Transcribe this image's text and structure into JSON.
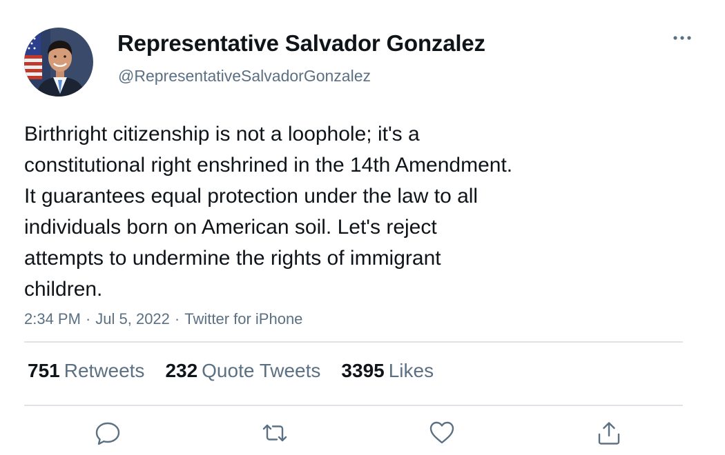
{
  "author": {
    "display_name": "Representative Salvador Gonzalez",
    "handle": "@RepresentativeSalvadorGonzalez"
  },
  "tweet": {
    "text": "Birthright citizenship is not a loophole; it's a\nconstitutional right enshrined in the 14th Amendment.\nIt guarantees equal protection under the law to all\nindividuals born on American soil. Let's reject\nattempts to undermine the rights of immigrant\nchildren.",
    "time": "2:34 PM",
    "separator": "·",
    "date": "Jul 5, 2022",
    "source": "Twitter for iPhone"
  },
  "stats": {
    "retweets_count": "751",
    "retweets_label": "Retweets",
    "quotes_count": "232",
    "quotes_label": "Quote Tweets",
    "likes_count": "3395",
    "likes_label": "Likes"
  },
  "icons": {
    "more": "more-horizontal-icon",
    "reply": "reply-icon",
    "retweet": "retweet-icon",
    "like": "heart-icon",
    "share": "share-icon"
  },
  "colors": {
    "text_primary": "#0f1419",
    "text_secondary": "#5b7083",
    "divider": "#dfe3e8"
  }
}
